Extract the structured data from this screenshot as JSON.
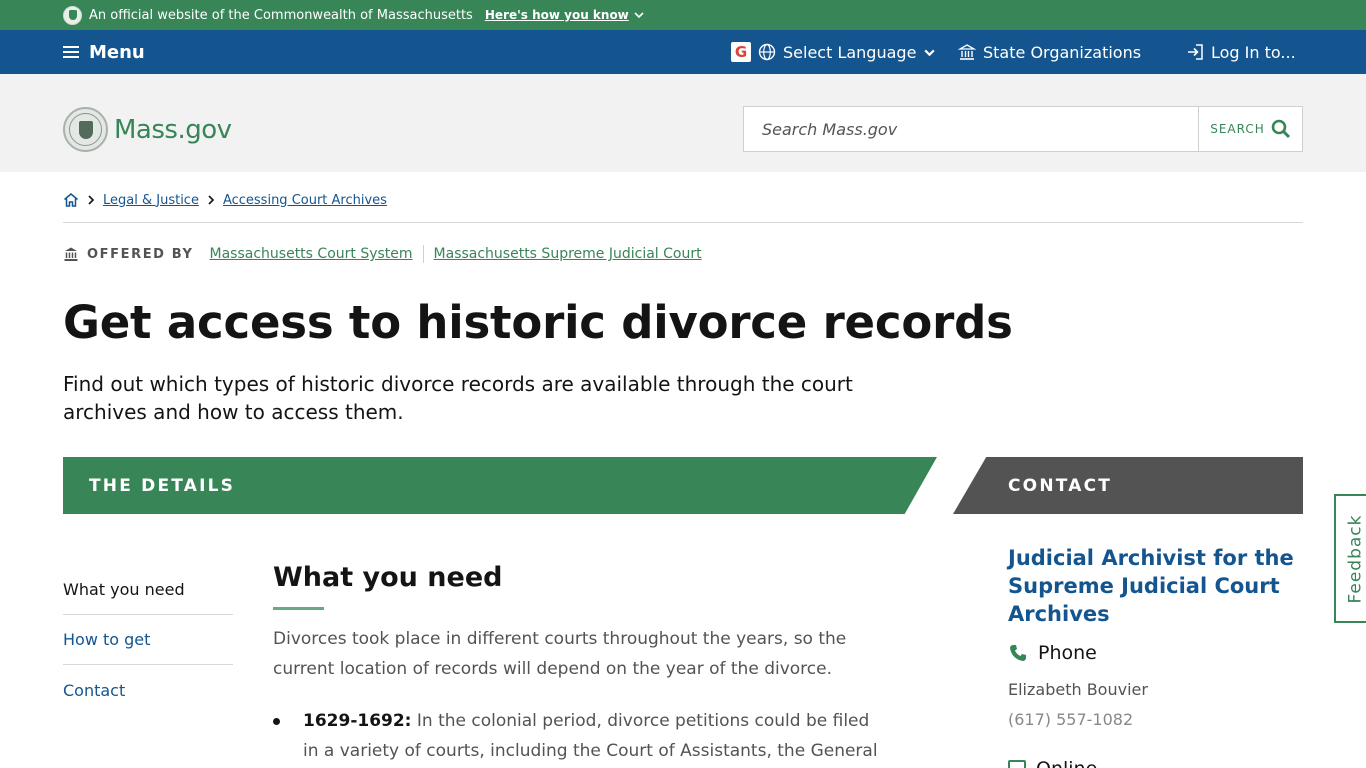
{
  "official_banner": {
    "text": "An official website of the Commonwealth of Massachusetts",
    "link": "Here's how you know"
  },
  "nav": {
    "menu_label": "Menu",
    "language_label": "Select Language",
    "orgs_label": "State Organizations",
    "login_label": "Log In to..."
  },
  "header": {
    "logo_text": "Mass.gov",
    "search_placeholder": "Search Mass.gov",
    "search_button": "SEARCH"
  },
  "breadcrumb": {
    "items": [
      "Legal & Justice",
      "Accessing Court Archives"
    ]
  },
  "offered_by": {
    "label": "OFFERED BY",
    "orgs": [
      "Massachusetts Court System",
      "Massachusetts Supreme Judicial Court"
    ]
  },
  "page": {
    "title": "Get access to historic divorce records",
    "lede": "Find out which types of historic divorce records are available through the court archives and how to access them."
  },
  "bands": {
    "details": "THE DETAILS",
    "contact": "CONTACT"
  },
  "toc": [
    "What you need",
    "How to get",
    "Contact"
  ],
  "section": {
    "title": "What you need",
    "paragraph": "Divorces took place in different courts throughout the years, so the current location of records will depend on the year of the divorce.",
    "items": [
      {
        "range": "1629-1692:",
        "text": "In the colonial period, divorce petitions could be filed in a variety of courts, including the Court of Assistants, the General"
      }
    ]
  },
  "contact": {
    "name": "Judicial Archivist for the Supreme Judicial Court Archives",
    "phone_label": "Phone",
    "person": "Elizabeth Bouvier",
    "phone_number": "(617) 557-1082",
    "online_label": "Online"
  },
  "feedback_label": "Feedback",
  "colors": {
    "green": "#388557",
    "blue": "#14558f",
    "gray": "#535353"
  }
}
